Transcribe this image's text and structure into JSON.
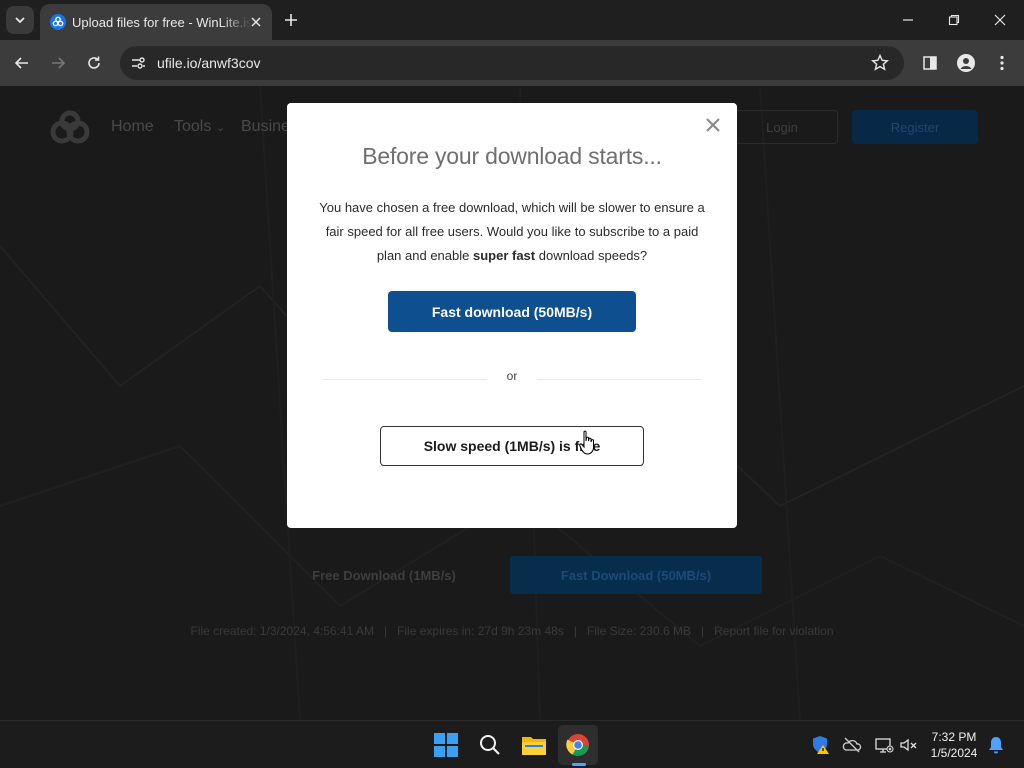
{
  "browser": {
    "tab_title": "Upload files for free - WinLite.iso",
    "url": "ufile.io/anwf3cov"
  },
  "page": {
    "nav": {
      "home": "Home",
      "tools": "Tools",
      "business": "Busine",
      "login": "Login",
      "register": "Register"
    },
    "free_download": "Free Download (1MB/s)",
    "fast_download": "Fast Download (50MB/s)",
    "file_info": "File created: 1/3/2024, 4:56:41 AM   |   File expires in: 27d 9h 23m 48s   |   File Size: 230.6 MB   |   Report file for violation"
  },
  "modal": {
    "title": "Before your download starts...",
    "body_part1": "You have chosen a free download, which will be slower to ensure a fair speed for all free users. Would you like to subscribe to a paid plan and enable ",
    "body_bold": "super fast",
    "body_part2": " download speeds?",
    "fast_button": "Fast download (50MB/s)",
    "or": "or",
    "slow_button": "Slow speed (1MB/s) is free"
  },
  "taskbar": {
    "time": "7:32 PM",
    "date": "1/5/2024"
  },
  "colors": {
    "modal_primary": "#0d4f8f",
    "browser_dark": "#1f1f1f",
    "toolbar": "#3c3c3c"
  }
}
